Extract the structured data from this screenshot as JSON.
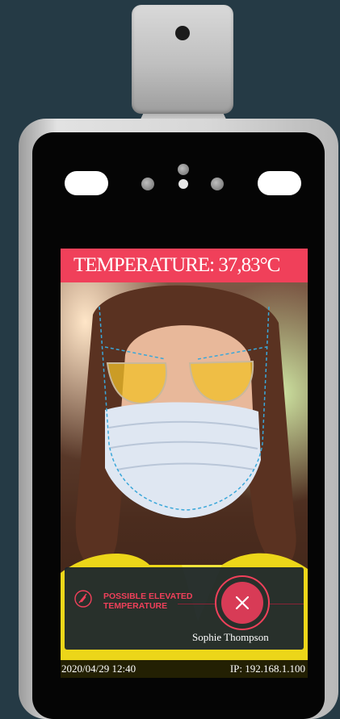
{
  "screen": {
    "temperature_label": "TEMPERATURE: 37,83°C",
    "alert_text": "POSSIBLE ELEVATED TEMPERATURE",
    "person_name": "Sophie Thompson",
    "datetime": "2020/04/29  12:40",
    "ip": "IP: 192.168.1.100"
  },
  "icons": {
    "reject": "close-icon",
    "alert": "thermometer-off-icon"
  },
  "colors": {
    "accent": "#f0405a",
    "background": "#253a45"
  }
}
